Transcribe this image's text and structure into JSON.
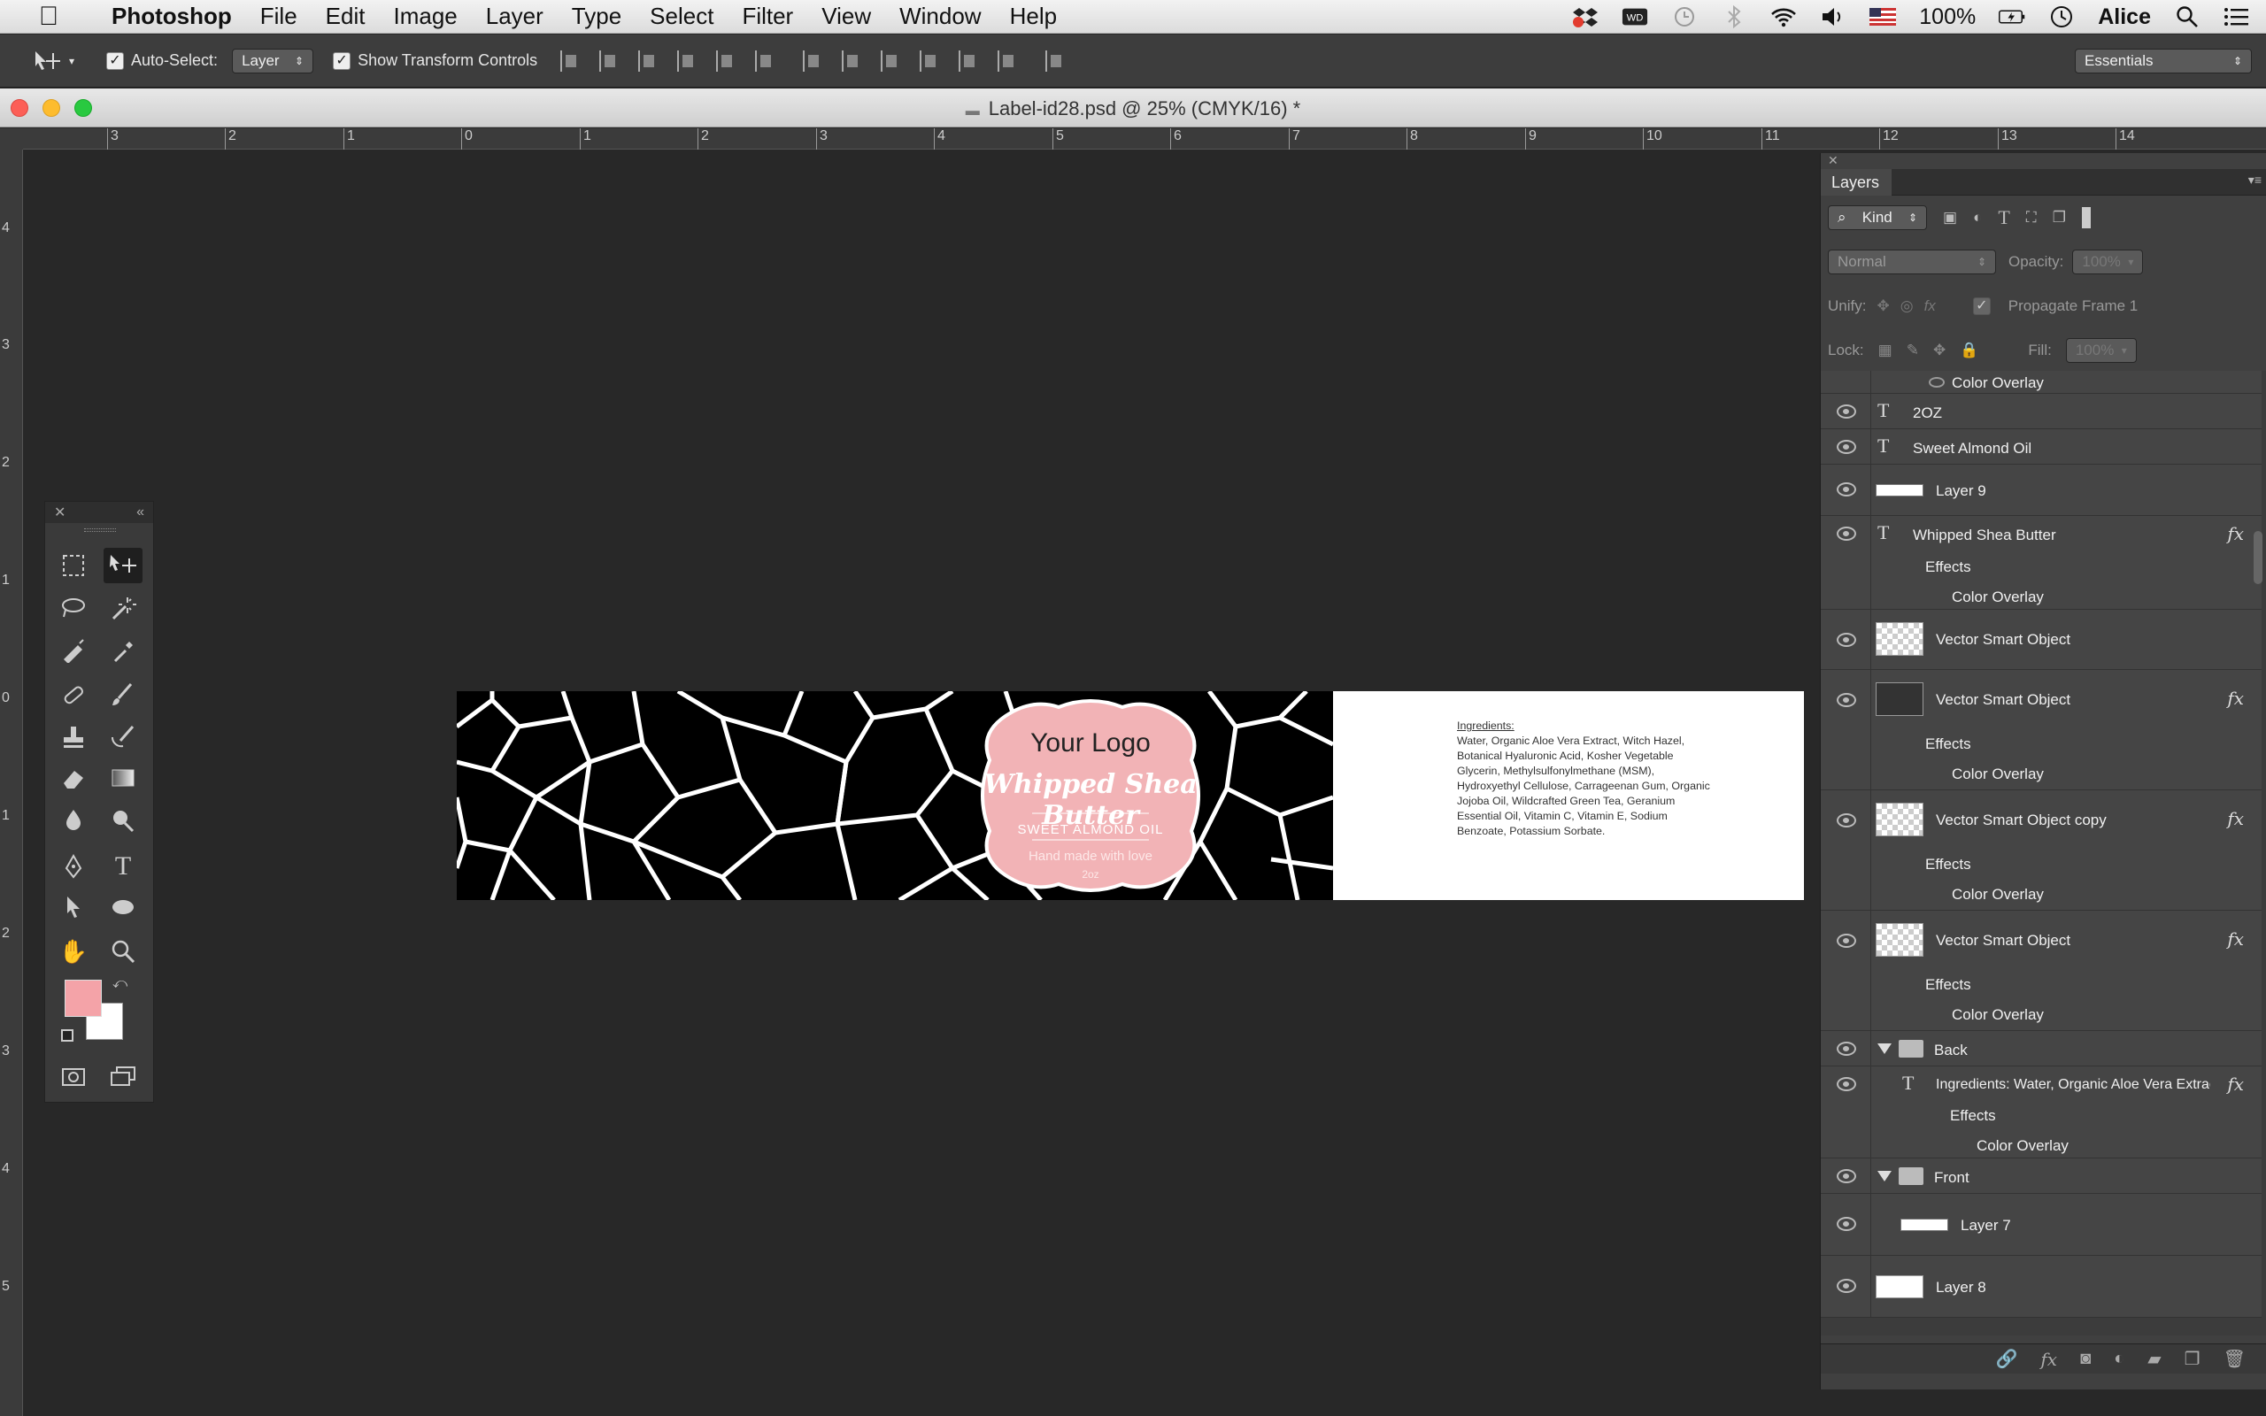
{
  "menubar": {
    "apple": "",
    "app_name": "Photoshop",
    "items": [
      "File",
      "Edit",
      "Image",
      "Layer",
      "Type",
      "Select",
      "Filter",
      "View",
      "Window",
      "Help"
    ],
    "status": {
      "battery": "100%",
      "user": "Alice"
    }
  },
  "options": {
    "auto_select_label": "Auto-Select:",
    "auto_select_value": "Layer",
    "show_transform_label": "Show Transform Controls",
    "workspace": "Essentials"
  },
  "document": {
    "title": "Label-id28.psd @ 25% (CMYK/16) *"
  },
  "rulers": {
    "horizontal": [
      "3",
      "2",
      "1",
      "0",
      "1",
      "2",
      "3",
      "4",
      "5",
      "6",
      "7",
      "8",
      "9",
      "10",
      "11",
      "12",
      "13",
      "14"
    ],
    "vertical": [
      "4",
      "3",
      "2",
      "1",
      "0",
      "1",
      "2",
      "3",
      "4",
      "5"
    ]
  },
  "label": {
    "logo": "Your Logo",
    "product": "Whipped Shea Butter",
    "subtitle": "SWEET ALMOND OIL",
    "tagline": "Hand made with love",
    "size": "2oz",
    "ingredients_heading": "Ingredients:",
    "ingredients_text": "Water, Organic Aloe Vera Extract, Witch Hazel, Botanical Hyaluronic Acid, Kosher Vegetable Glycerin, Methylsulfonylmethane (MSM), Hydroxyethyl Cellulose, Carrageenan Gum, Organic Jojoba Oil, Wildcrafted Green Tea, Geranium Essential Oil, Vitamin C, Vitamin E, Sodium Benzoate, Potassium Sorbate."
  },
  "layers_panel": {
    "tab": "Layers",
    "filter": "Kind",
    "blend_mode": "Normal",
    "opacity_label": "Opacity:",
    "opacity_value": "100%",
    "unify_label": "Unify:",
    "propagate_label": "Propagate Frame 1",
    "lock_label": "Lock:",
    "fill_label": "Fill:",
    "fill_value": "100%",
    "effects_label": "Effects",
    "color_overlay_label": "Color Overlay",
    "layers": {
      "l_2oz": "2OZ",
      "l_almond": "Sweet Almond Oil",
      "l_layer9": "Layer 9",
      "l_whipped": "Whipped Shea Butter",
      "l_vso1": "Vector Smart Object",
      "l_vso2": "Vector Smart Object",
      "l_vsocopy": "Vector Smart Object copy",
      "l_vso3": "Vector Smart Object",
      "g_back": "Back",
      "l_ingredients": "Ingredients: Water, Organic Aloe Vera Extract...",
      "g_front": "Front",
      "l_layer7": "Layer 7",
      "l_layer8": "Layer 8"
    }
  },
  "colors": {
    "foreground": "#f4a3a8",
    "background": "#ffffff",
    "badge_pink": "#f2b3b6"
  }
}
